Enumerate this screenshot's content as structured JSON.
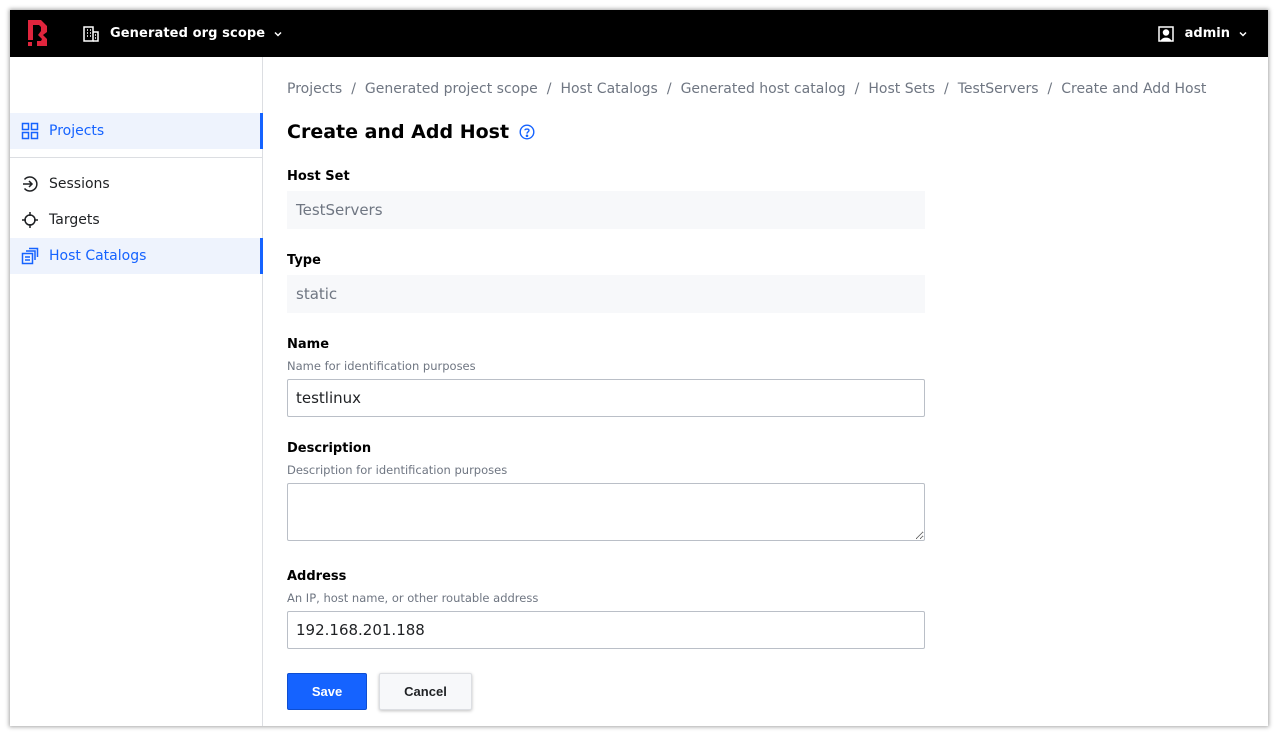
{
  "header": {
    "org_scope_label": "Generated org scope",
    "user_label": "admin"
  },
  "sidebar": {
    "items": [
      {
        "label": "Projects",
        "icon": "grid-icon",
        "active": true
      },
      {
        "label": "Sessions",
        "icon": "session-arrow-icon",
        "active": false
      },
      {
        "label": "Targets",
        "icon": "crosshair-icon",
        "active": false
      },
      {
        "label": "Host Catalogs",
        "icon": "host-catalog-icon",
        "active": true
      }
    ]
  },
  "breadcrumb": [
    "Projects",
    "Generated project scope",
    "Host Catalogs",
    "Generated host catalog",
    "Host Sets",
    "TestServers",
    "Create and Add Host"
  ],
  "breadcrumb_separator": "/",
  "page": {
    "title": "Create and Add Host"
  },
  "form": {
    "host_set": {
      "label": "Host Set",
      "value": "TestServers"
    },
    "type": {
      "label": "Type",
      "value": "static"
    },
    "name": {
      "label": "Name",
      "help": "Name for identification purposes",
      "value": "testlinux"
    },
    "description": {
      "label": "Description",
      "help": "Description for identification purposes",
      "value": ""
    },
    "address": {
      "label": "Address",
      "help": "An IP, host name, or other routable address",
      "value": "192.168.201.188"
    },
    "save_label": "Save",
    "cancel_label": "Cancel"
  },
  "colors": {
    "accent": "#1563ff",
    "topbar": "#000000",
    "logo": "#e0253d"
  }
}
